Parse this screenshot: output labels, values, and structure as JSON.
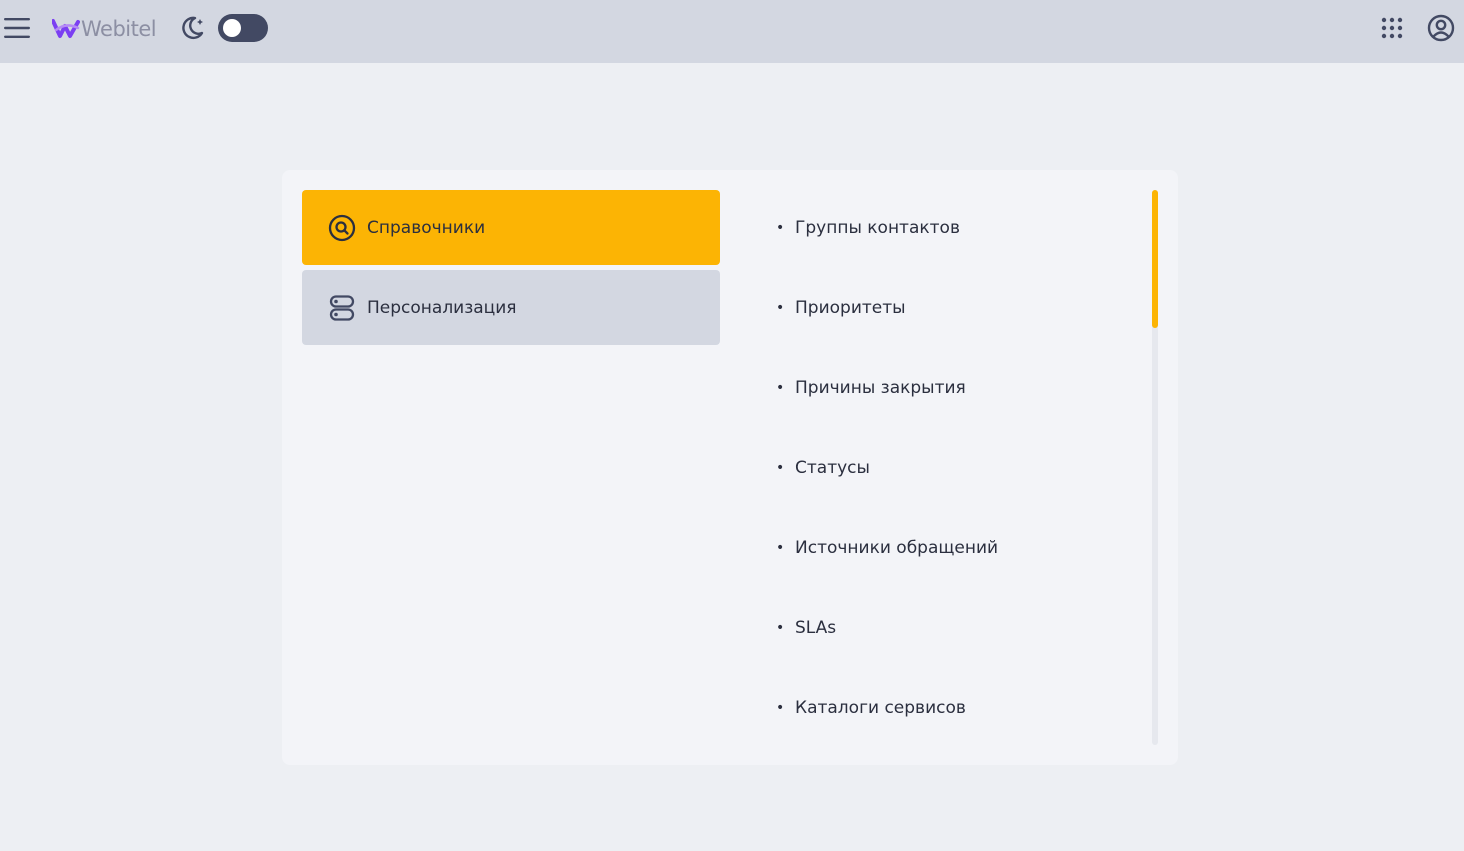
{
  "header": {
    "menu_icon": "hamburger-icon",
    "logo_text": "Webitel",
    "theme_icon": "moon-icon",
    "apps_icon": "grid-icon",
    "account_icon": "account-circle-icon"
  },
  "nav": {
    "items": [
      {
        "label": "Справочники",
        "icon": "search-circle-icon",
        "active": true
      },
      {
        "label": "Персонализация",
        "icon": "toggles-icon",
        "active": false
      }
    ]
  },
  "list": {
    "items": [
      {
        "label": "Группы контактов"
      },
      {
        "label": "Приоритеты"
      },
      {
        "label": "Причины закрытия"
      },
      {
        "label": "Статусы"
      },
      {
        "label": "Источники обращений"
      },
      {
        "label": "SLAs"
      },
      {
        "label": "Каталоги сервисов"
      }
    ]
  },
  "colors": {
    "accent": "#fcb404",
    "topbar": "#d3d7e1",
    "background": "#edeff3",
    "card": "#f3f4f8",
    "text": "#2b2f3f",
    "logo_purple": "#7b3ff2"
  }
}
